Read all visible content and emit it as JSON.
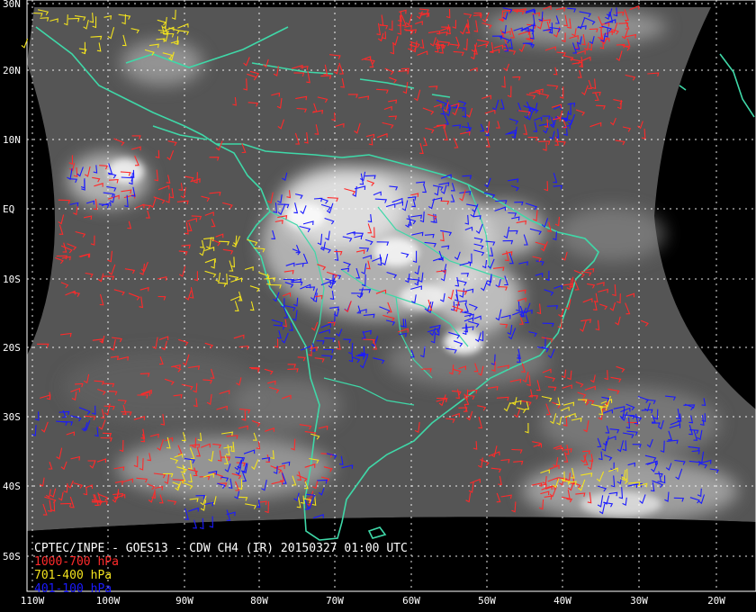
{
  "colors": {
    "background": "#000000",
    "frame": "#ffffff",
    "coastline": "#3fd8a8",
    "grid": "#ffffff",
    "wind_low": "#ff2a2a",
    "wind_mid": "#f2e21e",
    "wind_high": "#1a1aff",
    "title_text": "#ffffff"
  },
  "map": {
    "title": "CPTEC/INPE - GOES13 - CDW CH4 (IR) 20150327 01:00 UTC",
    "lat_labels": [
      "30N",
      "20N",
      "10N",
      "EQ",
      "10S",
      "20S",
      "30S",
      "40S",
      "50S"
    ],
    "lon_labels": [
      "110W",
      "100W",
      "90W",
      "80W",
      "70W",
      "60W",
      "50W",
      "40W",
      "30W",
      "20W"
    ],
    "legend": [
      {
        "label": "1000-700 hPa",
        "color_key": "wind_low"
      },
      {
        "label": "701-400 hPa",
        "color_key": "wind_mid"
      },
      {
        "label": "401-100 hPa",
        "color_key": "wind_high"
      }
    ]
  }
}
